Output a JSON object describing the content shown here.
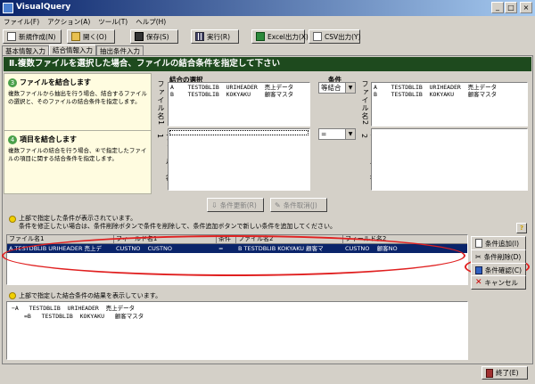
{
  "window": {
    "title": "VisualQuery"
  },
  "menu": [
    "ファイル(F)",
    "アクション(A)",
    "ツール(T)",
    "ヘルプ(H)"
  ],
  "toolbar": {
    "new": "新規作成(N)",
    "open": "開く(O)",
    "save": "保存(S)",
    "run": "実行(R)",
    "excel": "Excel出力(X)",
    "csv": "CSV出力(Y)"
  },
  "tabs": [
    "基本情報入力",
    "結合情報入力",
    "抽出条件入力"
  ],
  "banner": "Ⅱ.複数ファイルを選択した場合、ファイルの結合条件を指定して下さい",
  "help": {
    "file_title": "ファイルを結合します",
    "file_desc": "複数ファイルから抽出を行う場合、結合するファイルの選択と、そのファイルの結合条件を指定します。",
    "field_title": "項目を結合します",
    "field_desc": "複数ファイルの結合を行う場合、④で指定したファイルの項目に関する結合条件を指定します。"
  },
  "join": {
    "selection_label": "結合の選択",
    "condition_label": "条件",
    "file1_label": "ファイル名1",
    "file2_label": "ファイル名2",
    "field1_label": "フィールド名1",
    "field2_label": "フィールド名2",
    "join_type": "等結合",
    "operator": "=",
    "file_list1": [
      "A    TESTDBLIB  URIHEADER  売上データ",
      "B    TESTDBLIB  KOKYAKU    顧客マスタ"
    ],
    "file_list2": [
      "A    TESTDBLIB  URIHEADER  売上データ",
      "B    TESTDBLIB  KOKYAKU    顧客マスタ"
    ],
    "update_button": "条件更新(R)",
    "cancel_button": "条件取消(J)"
  },
  "conditions": {
    "info_line1": "上部で指定した条件が表示されています。",
    "info_line2": "条件を修正したい場合は、条件削除ボタンで条件を削除して、条件追加ボタンで新しい条件を追加してください。",
    "headers": [
      "ファイル名1",
      "フィールド名1",
      "条件",
      "ファイル名2",
      "フィールド名2"
    ],
    "rows": [
      [
        "A  TESTDBLIB  URIHEADER  売上デ",
        "CUSTNO    CUSTNO",
        "=",
        "B  TESTDBLIB  KOKYAKU  顧客マ",
        "CUSTNO    顧客NO"
      ]
    ],
    "add_button": "条件追加(I)",
    "delete_button": "条件削除(D)",
    "confirm_button": "条件確認(C)",
    "cancel_button": "キャンセル",
    "help_glyph": "?"
  },
  "result": {
    "info": "上部で指定した結合条件の結果を表示しています。",
    "tree": [
      "−A   TESTDBLIB  URIHEADER  売上データ",
      "=B   TESTDBLIB  KOKYAKU   顧客マスタ"
    ]
  },
  "footer": {
    "exit_button": "終了(E)"
  },
  "colors": {
    "banner_bg": "#1e4a1e",
    "title_bar": "#0a246a",
    "selection": "#0a246a",
    "highlight_ring": "#e02020",
    "help_panel": "#fffce0"
  }
}
